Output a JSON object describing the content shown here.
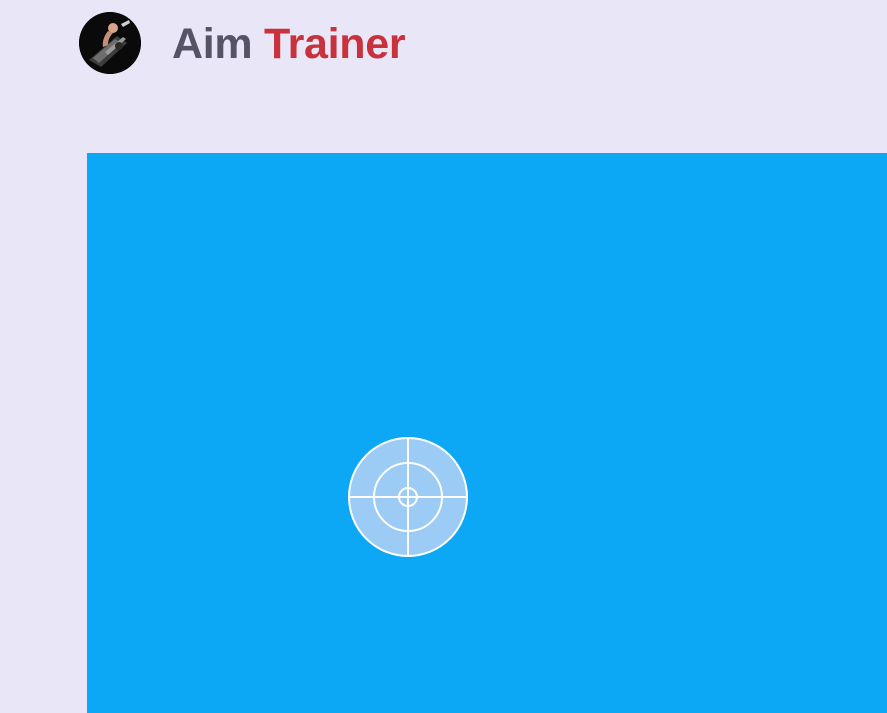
{
  "app": {
    "title_part_1": "Aim",
    "title_part_2": "Trainer",
    "logo_icon": "gamer-avatar-icon"
  },
  "colors": {
    "page_background": "#e8e6f7",
    "play_area_background": "#0ca8f6",
    "title_part_1": "#555365",
    "title_part_2": "#c8323c",
    "target_fill": "#9ccbf6",
    "target_lines": "#ffffff"
  },
  "game": {
    "target_icon": "crosshair-target-icon"
  }
}
